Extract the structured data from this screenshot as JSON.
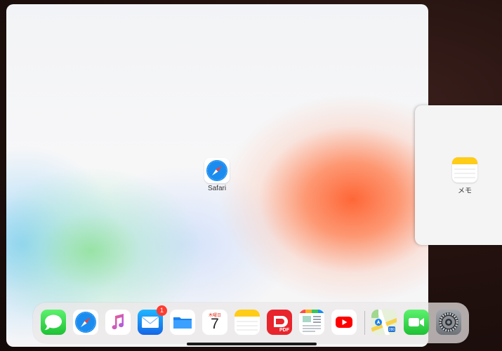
{
  "app_switcher": {
    "main_window": {
      "app_name": "Safari",
      "icon": "safari-compass-icon"
    },
    "slide_over_window": {
      "app_name": "メモ",
      "icon": "notes-icon"
    }
  },
  "dock": {
    "apps": [
      {
        "name": "messages",
        "icon": "messages-icon"
      },
      {
        "name": "safari",
        "icon": "safari-compass-icon"
      },
      {
        "name": "music",
        "icon": "music-note-icon"
      },
      {
        "name": "mail",
        "icon": "mail-envelope-icon",
        "badge": "1"
      },
      {
        "name": "files",
        "icon": "folder-icon"
      },
      {
        "name": "calendar",
        "icon": "calendar-icon",
        "weekday": "木曜日",
        "day": "7"
      },
      {
        "name": "notes",
        "icon": "notes-icon"
      },
      {
        "name": "pdf-expert",
        "icon": "pdf-icon",
        "label": "PDF"
      },
      {
        "name": "news",
        "icon": "news-icon"
      },
      {
        "name": "youtube",
        "icon": "youtube-play-icon"
      },
      {
        "name": "maps",
        "icon": "maps-icon",
        "shield": "280"
      },
      {
        "name": "facetime",
        "icon": "video-camera-icon"
      },
      {
        "name": "settings",
        "icon": "gear-icon"
      }
    ]
  },
  "colors": {
    "accent_red": "#ff3b30",
    "messages_green": "#34c759",
    "mail_blue": "#1d8ef5",
    "youtube_red": "#ff0000"
  }
}
